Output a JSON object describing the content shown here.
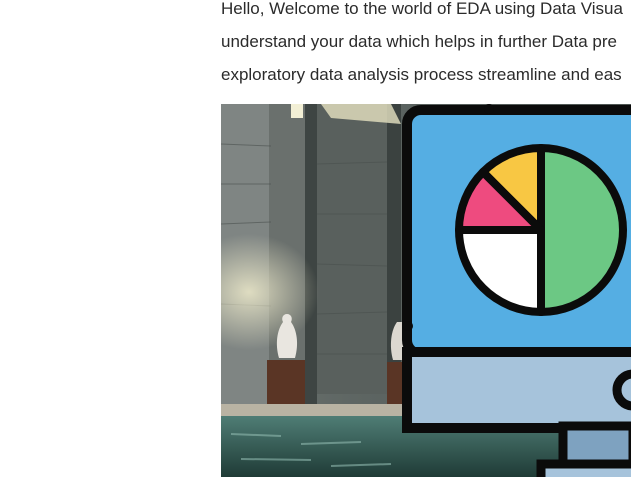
{
  "intro": {
    "lines": [
      "Hello, Welcome to the world of EDA using Data Visua",
      "understand your data which helps in further Data pre",
      "exploratory data analysis process streamline and eas"
    ]
  },
  "hero_image": {
    "icon": "monitor-pie-chart-icon",
    "colors": {
      "screen": "#55aee3",
      "outline": "#0b0b0b",
      "slice_green": "#6cc884",
      "slice_yellow": "#f8c743",
      "slice_pink": "#ee4b7f",
      "slice_white": "#ffffff",
      "monitor_base": "#a6c3db",
      "stand": "#7ea2c0",
      "wall": "#5a625f",
      "water": "#2f5550"
    }
  }
}
